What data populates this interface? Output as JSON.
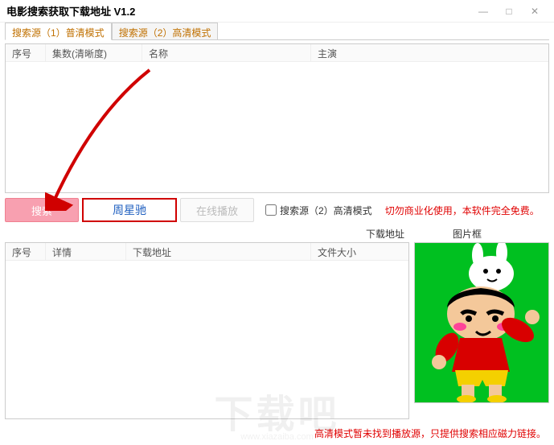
{
  "window": {
    "title": "电影搜索获取下载地址 V1.2",
    "minimize": "—",
    "maximize": "□",
    "close": "✕"
  },
  "tabs": {
    "tab1": "搜索源（1）普清模式",
    "tab2": "搜索源（2）高清模式"
  },
  "upperTable": {
    "col1": "序号",
    "col2": "集数(清晰度)",
    "col3": "名称",
    "col4": "主演"
  },
  "actions": {
    "searchBtn": "搜索",
    "searchValue": "周星驰",
    "playBtn": "在线播放",
    "checkboxLabel": "搜索源（2）高清模式",
    "warning": "切勿商业化使用，本软件完全免费。"
  },
  "labelsRow": {
    "dlAddr": "下载地址",
    "picFrame": "图片框"
  },
  "lowerTable": {
    "col1": "序号",
    "col2": "详情",
    "col3": "下载地址",
    "col4": "文件大小"
  },
  "bottomNote": "高清模式暂未找到播放源，只提供搜索相应磁力链接。",
  "watermark": {
    "text": "下载吧",
    "url": "www.xiazaiba.com"
  }
}
